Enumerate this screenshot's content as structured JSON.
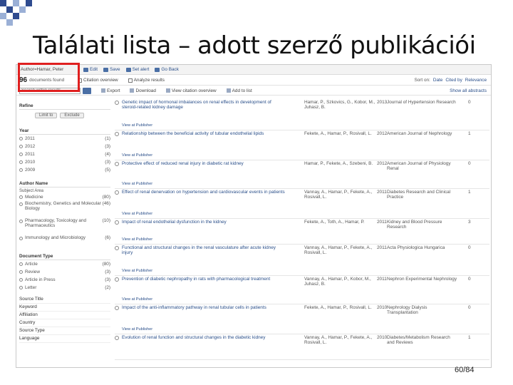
{
  "slide": {
    "title": "Találati lista – adott szerző publikációi",
    "page_number": "60/84"
  },
  "toolbar": {
    "crumb": "Author=Hamar, Peter",
    "buttons": [
      "Edit",
      "Save",
      "Set alert",
      "Go Back"
    ]
  },
  "results": {
    "count": "96",
    "count_label": "documents found",
    "views": [
      "Citation overview",
      "Analyze results"
    ],
    "sort_label": "Sort on:",
    "sort_options": [
      "Date",
      "Cited by",
      "Relevance"
    ]
  },
  "search": {
    "placeholder": "Search within results...",
    "tools": [
      "Export",
      "Download",
      "View citation overview",
      "Add to list"
    ],
    "show_abstracts": "Show all abstracts"
  },
  "facets": {
    "refine_heading": "Refine",
    "refine_buttons": [
      "Limit to",
      "Exclude"
    ],
    "year": {
      "heading": "Year",
      "items": [
        {
          "label": "2011",
          "count": "(1)"
        },
        {
          "label": "2012",
          "count": "(3)"
        },
        {
          "label": "2011",
          "count": "(4)"
        },
        {
          "label": "2010",
          "count": "(3)"
        },
        {
          "label": "2009",
          "count": "(5)"
        }
      ]
    },
    "author": {
      "heading": "Author Name"
    },
    "subject": {
      "heading": "Subject Area",
      "items": [
        {
          "label": "Medicine",
          "count": "(80)"
        },
        {
          "label": "Biochemistry, Genetics and Molecular Biology",
          "count": "(46)"
        },
        {
          "label": "Pharmacology, Toxicology and Pharmaceutics",
          "count": "(10)"
        },
        {
          "label": "Immunology and Microbiology",
          "count": "(6)"
        }
      ]
    },
    "doctype": {
      "heading": "Document Type",
      "items": [
        {
          "label": "Article",
          "count": "(80)"
        },
        {
          "label": "Review",
          "count": "(3)"
        },
        {
          "label": "Article in Press",
          "count": "(3)"
        },
        {
          "label": "Letter",
          "count": "(2)"
        }
      ]
    },
    "more": [
      "Source Title",
      "Keyword",
      "Affiliation",
      "Country",
      "Source Type",
      "Language"
    ]
  },
  "records": [
    {
      "title": "Genetic impact of hormonal imbalances on renal effects in development of steroid-related kidney damage",
      "authors": "Hamar, P., Szkovics, G., Kobor, M., Juhasz, B.",
      "year": "2013",
      "source": "Journal of Hypertension Research",
      "cites": "0"
    },
    {
      "title": "Relationship between the beneficial activity of tubular endothelial lipids",
      "authors": "Fekete, A., Hamar, P., Rosivall, L.",
      "year": "2012",
      "source": "American Journal of Nephrology",
      "cites": "1"
    },
    {
      "title": "Protective effect of reduced renal injury in diabetic rat kidney",
      "authors": "Hamar, P., Fekete, A., Szebeni, B.",
      "year": "2012",
      "source": "American Journal of Physiology Renal",
      "cites": "0"
    },
    {
      "title": "Effect of renal denervation on hypertension and cardiovascular events in patients",
      "authors": "Vannay, A., Hamar, P., Fekete, A., Rosivall, L.",
      "year": "2011",
      "source": "Diabetes Research and Clinical Practice",
      "cites": "1"
    },
    {
      "title": "Impact of renal endothelial dysfunction in the kidney",
      "authors": "Fekete, A., Toth, A., Hamar, P.",
      "year": "2011",
      "source": "Kidney and Blood Pressure Research",
      "cites": "3"
    },
    {
      "title": "Functional and structural changes in the renal vasculature after acute kidney injury",
      "authors": "Vannay, A., Hamar, P., Fekete, A., Rosivall, L.",
      "year": "2011",
      "source": "Acta Physiologica Hungarica",
      "cites": "0"
    },
    {
      "title": "Prevention of diabetic nephropathy in rats with pharmacological treatment",
      "authors": "Vannay, A., Hamar, P., Kobor, M., Juhasz, B.",
      "year": "2011",
      "source": "Nephron Experimental Nephrology",
      "cites": "0"
    },
    {
      "title": "Impact of the anti-inflammatory pathway in renal tubular cells in patients",
      "authors": "Fekete, A., Hamar, P., Rosivall, L.",
      "year": "2010",
      "source": "Nephrology Dialysis Transplantation",
      "cites": "0"
    },
    {
      "title": "Evolution of renal function and structural changes in the diabetic kidney",
      "authors": "Vannay, A., Hamar, P., Fekete, A., Rosivall, L.",
      "year": "2010",
      "source": "Diabetes/Metabolism Research and Reviews",
      "cites": "1"
    }
  ],
  "record_link": "View at Publisher",
  "colors": {
    "link": "#2a4f8a",
    "highlight": "#e02020",
    "corner_blue": "#2f4b8f",
    "corner_light": "#9bb0d6"
  }
}
